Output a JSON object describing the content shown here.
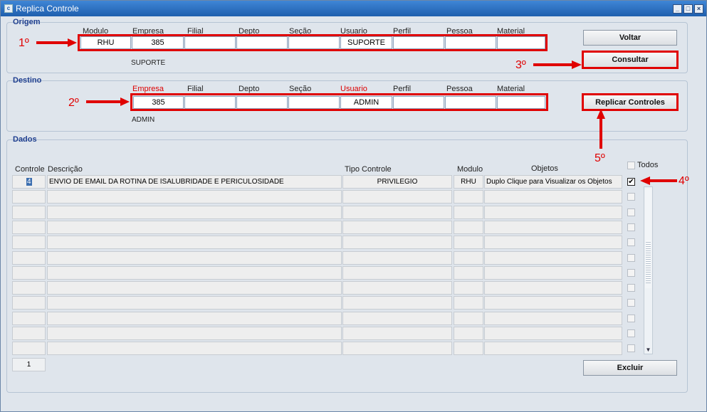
{
  "window": {
    "title": "Replica Controle"
  },
  "origem": {
    "title": "Origem",
    "labels": [
      "Modulo",
      "Empresa",
      "Filial",
      "Depto",
      "Seção",
      "Usuario",
      "Perfil",
      "Pessoa",
      "Material"
    ],
    "values": [
      "RHU",
      "385",
      "",
      "",
      "",
      "SUPORTE",
      "",
      "",
      ""
    ],
    "user_name": "SUPORTE"
  },
  "destino": {
    "title": "Destino",
    "labels": [
      "Empresa",
      "Filial",
      "Depto",
      "Seção",
      "Usuario",
      "Perfil",
      "Pessoa",
      "Material"
    ],
    "values": [
      "385",
      "",
      "",
      "",
      "ADMIN",
      "",
      "",
      ""
    ],
    "user_name": "ADMIN"
  },
  "dados": {
    "title": "Dados",
    "todos_label": "Todos",
    "columns": [
      "Controle",
      "Descrição",
      "Tipo Controle",
      "Modulo",
      "Objetos"
    ],
    "rows": [
      {
        "controle": "4",
        "descricao": "ENVIO DE EMAIL DA ROTINA DE ISALUBRIDADE E PERICULOSIDADE",
        "tipo": "PRIVILEGIO",
        "modulo": "RHU",
        "objetos": "Duplo Clique para Visualizar os Objetos",
        "checked": true
      }
    ],
    "record_count": "1"
  },
  "buttons": {
    "voltar": "Voltar",
    "consultar": "Consultar",
    "replicar": "Replicar Controles",
    "excluir": "Excluir"
  },
  "steps": {
    "s1": "1º",
    "s2": "2º",
    "s3": "3º",
    "s4": "4º",
    "s5": "5º"
  },
  "colors": {
    "annotation": "#e00000",
    "title_bar": "#1f5fae",
    "group_title": "#1f3f8f"
  }
}
